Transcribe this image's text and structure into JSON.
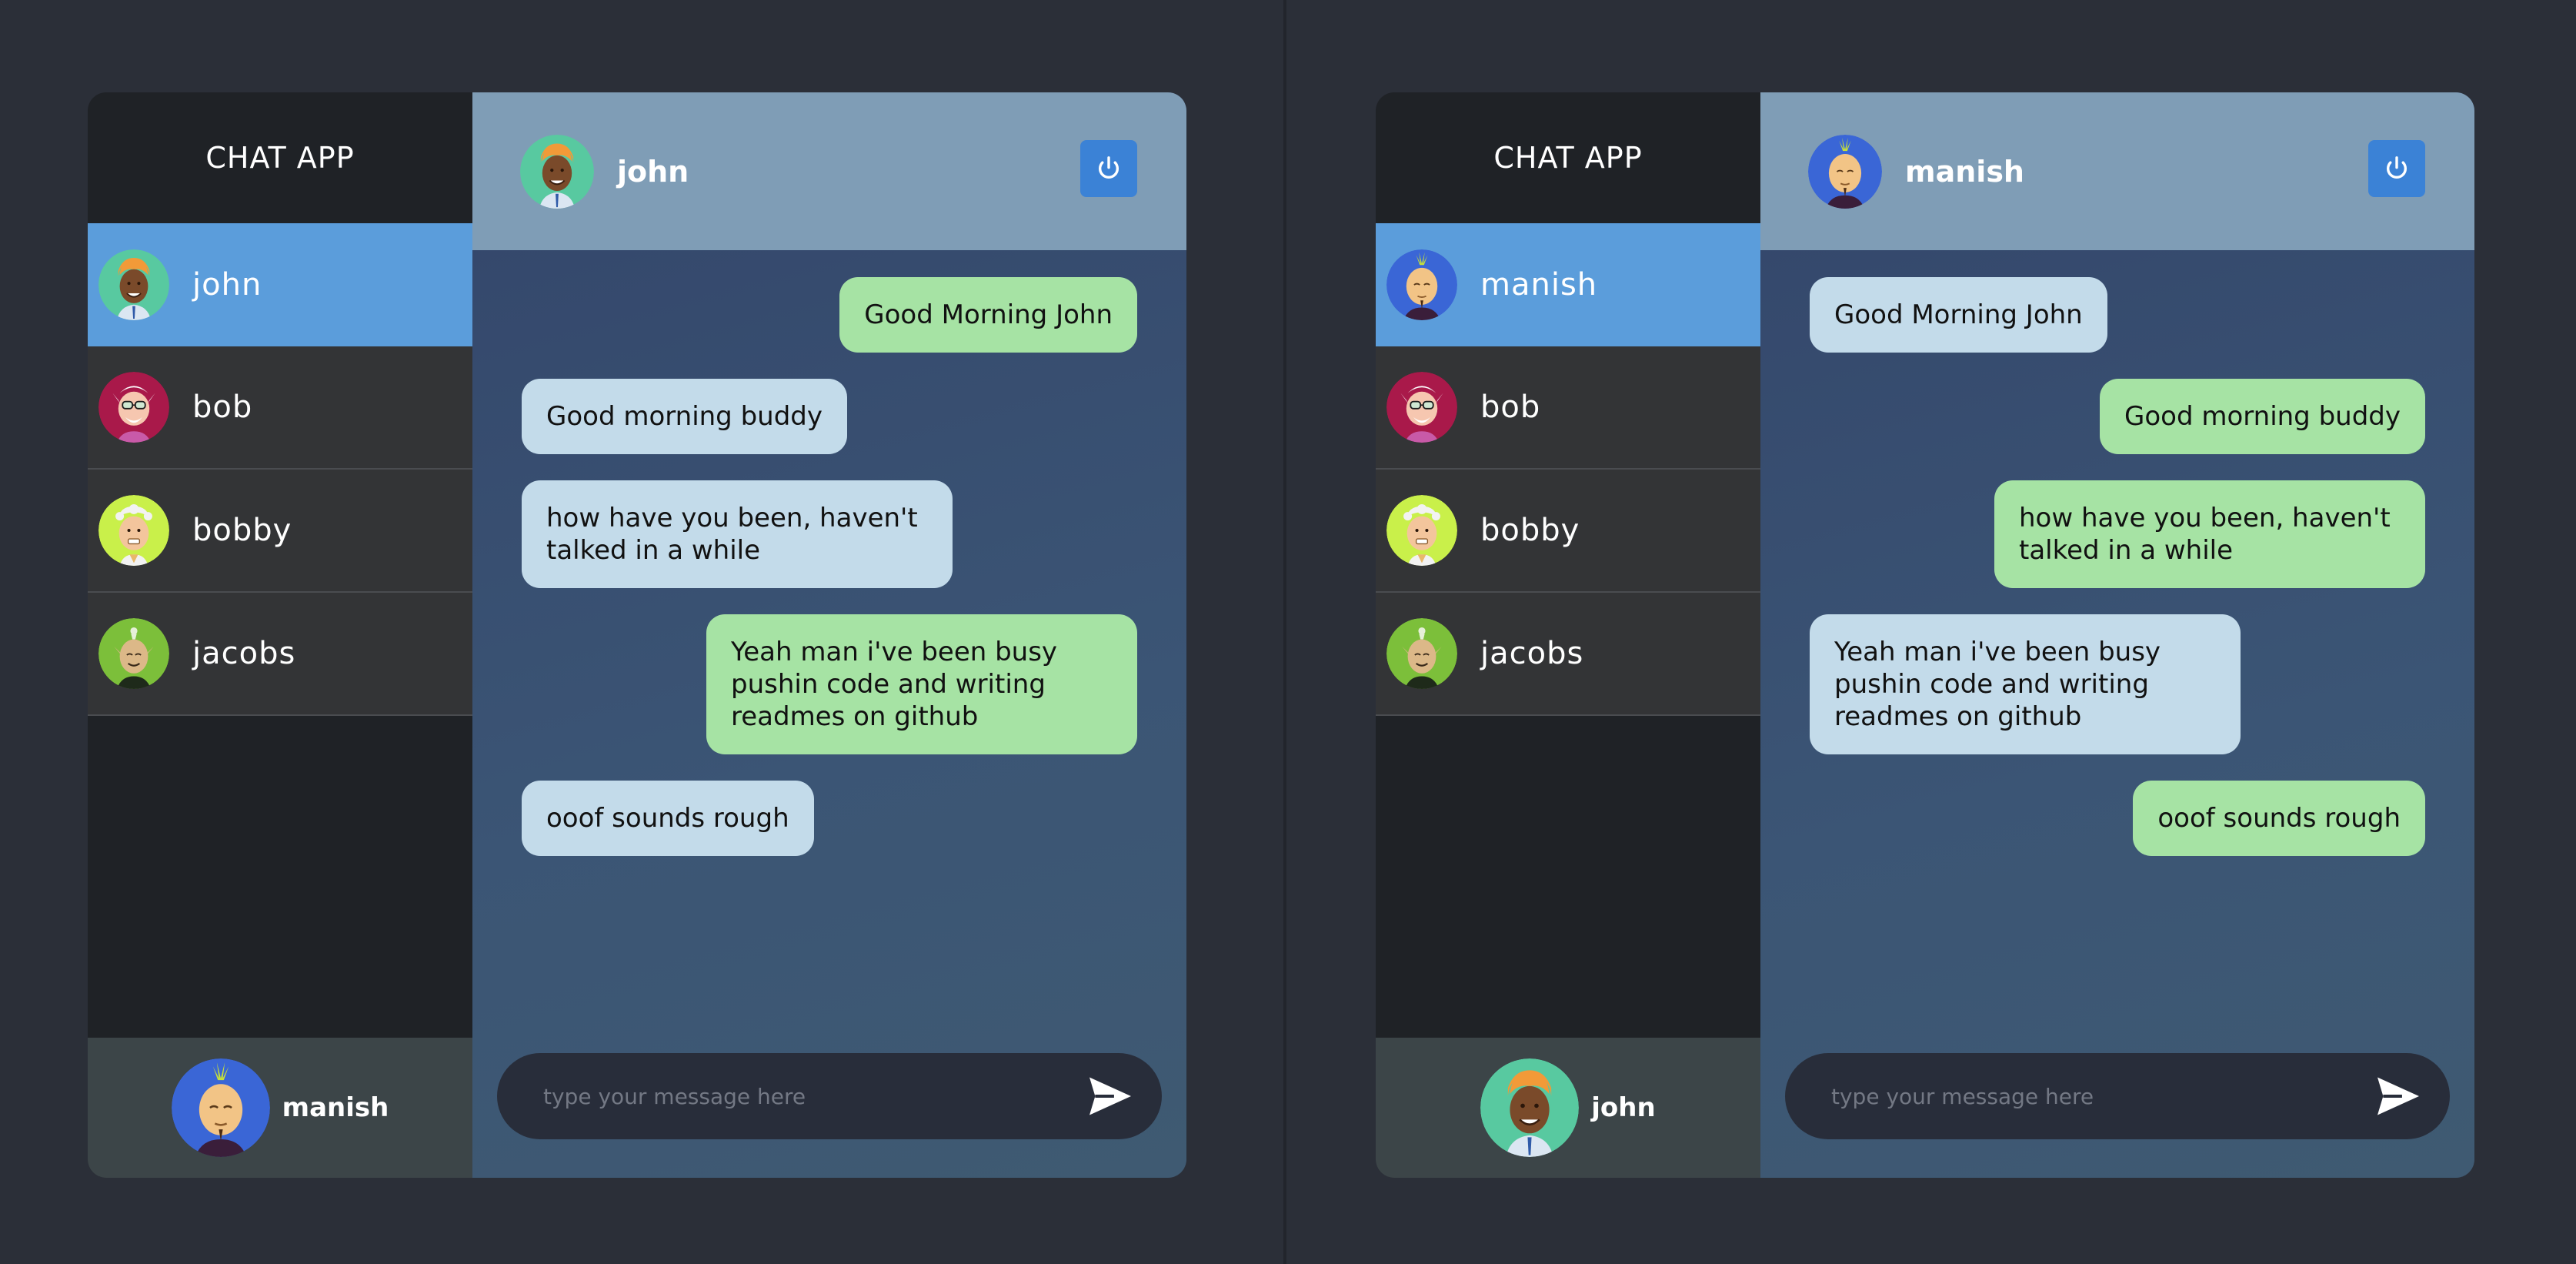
{
  "left": {
    "app_title": "CHAT APP",
    "contacts": [
      {
        "name": "john",
        "avatar": "john",
        "active": true
      },
      {
        "name": "bob",
        "avatar": "bob",
        "active": false
      },
      {
        "name": "bobby",
        "avatar": "bobby",
        "active": false
      },
      {
        "name": "jacobs",
        "avatar": "jacobs",
        "active": false
      }
    ],
    "current_user": {
      "name": "manish",
      "avatar": "manish"
    },
    "chat_header": {
      "name": "john",
      "avatar": "john"
    },
    "messages": [
      {
        "text": "Good Morning John",
        "direction": "out"
      },
      {
        "text": "Good morning buddy",
        "direction": "in"
      },
      {
        "text": "how have you been, haven't talked in a while",
        "direction": "in"
      },
      {
        "text": "Yeah man i've been busy pushin code and writing readmes on github",
        "direction": "out"
      },
      {
        "text": "ooof sounds rough",
        "direction": "in"
      }
    ],
    "composer": {
      "placeholder": "type your message here"
    }
  },
  "right": {
    "app_title": "CHAT APP",
    "contacts": [
      {
        "name": "manish",
        "avatar": "manish",
        "active": true
      },
      {
        "name": "bob",
        "avatar": "bob",
        "active": false
      },
      {
        "name": "bobby",
        "avatar": "bobby",
        "active": false
      },
      {
        "name": "jacobs",
        "avatar": "jacobs",
        "active": false
      }
    ],
    "current_user": {
      "name": "john",
      "avatar": "john"
    },
    "chat_header": {
      "name": "manish",
      "avatar": "manish"
    },
    "messages": [
      {
        "text": "Good Morning John",
        "direction": "in"
      },
      {
        "text": "Good morning buddy",
        "direction": "out"
      },
      {
        "text": "how have you been, haven't talked in a while",
        "direction": "out"
      },
      {
        "text": "Yeah man i've been busy pushin code and writing readmes on github",
        "direction": "in"
      },
      {
        "text": "ooof sounds rough",
        "direction": "out"
      }
    ],
    "composer": {
      "placeholder": "type your message here"
    }
  },
  "icons": {
    "logout": "power-icon",
    "send": "send-icon"
  },
  "colors": {
    "active_contact": "#5b9ddb",
    "incoming_bubble": "#c3dbea",
    "outgoing_bubble": "#a6e3a4",
    "header": "#7f9db6",
    "power_button": "#3b82d6"
  }
}
